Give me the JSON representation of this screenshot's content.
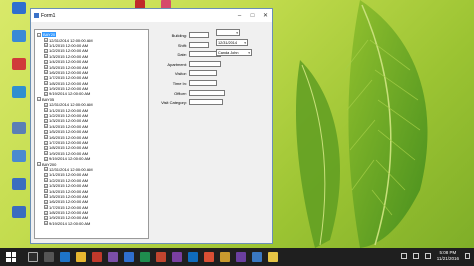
{
  "window": {
    "title": "Form1",
    "minimize_icon": "minimize-icon",
    "maximize_icon": "maximize-icon",
    "close_icon": "close-icon"
  },
  "tree": {
    "groups": [
      {
        "label": "BAY20",
        "selected": true,
        "children": [
          "12/31/2014 12:00:00 AM",
          "1/1/2015 12:00:00 AM",
          "1/2/2015 12:00:00 AM",
          "1/3/2015 12:00:00 AM",
          "1/4/2015 12:00:00 AM",
          "1/5/2015 12:00:00 AM",
          "1/6/2015 12:00:00 AM",
          "1/7/2015 12:00:00 AM",
          "1/8/2015 12:00:00 AM",
          "1/9/2015 12:00:00 AM",
          "9/19/2014 12:00:00 AM"
        ]
      },
      {
        "label": "BAY05",
        "selected": false,
        "children": [
          "12/31/2014 12:00:00 AM",
          "1/1/2015 12:00:00 AM",
          "1/2/2015 12:00:00 AM",
          "1/3/2015 12:00:00 AM",
          "1/4/2015 12:00:00 AM",
          "1/5/2015 12:00:00 AM",
          "1/6/2015 12:00:00 AM",
          "1/7/2015 12:00:00 AM",
          "1/8/2015 12:00:00 AM",
          "1/9/2015 12:00:00 AM",
          "9/19/2014 12:00:00 AM"
        ]
      },
      {
        "label": "BAY200",
        "selected": false,
        "children": [
          "12/31/2014 12:00:00 AM",
          "1/1/2015 12:00:00 AM",
          "1/2/2015 12:00:00 AM",
          "1/3/2015 12:00:00 AM",
          "1/4/2015 12:00:00 AM",
          "1/5/2015 12:00:00 AM",
          "1/6/2015 12:00:00 AM",
          "1/7/2015 12:00:00 AM",
          "1/8/2015 12:00:00 AM",
          "1/9/2015 12:00:00 AM",
          "9/19/2014 12:00:00 AM"
        ]
      }
    ]
  },
  "fields": [
    {
      "label": "Building:",
      "value": ""
    },
    {
      "label": "Shift:",
      "value": ""
    },
    {
      "label": "Date:",
      "value": ""
    },
    {
      "label": "Apartment:",
      "value": ""
    },
    {
      "label": "Visitor:",
      "value": ""
    },
    {
      "label": "Time In:",
      "value": ""
    },
    {
      "label": "Officer:",
      "value": ""
    },
    {
      "label": "Visit Category:",
      "value": ""
    }
  ],
  "combos": [
    {
      "value": ""
    },
    {
      "value": "12/31/2014"
    },
    {
      "value": "Canda John"
    }
  ],
  "taskbar": {
    "time": "5:08 PM",
    "date": "11/21/2016"
  },
  "colors": {
    "tree_selection": "#3399ff",
    "taskbar": "#1f1f1f",
    "wallpaper": "#b6d240"
  }
}
